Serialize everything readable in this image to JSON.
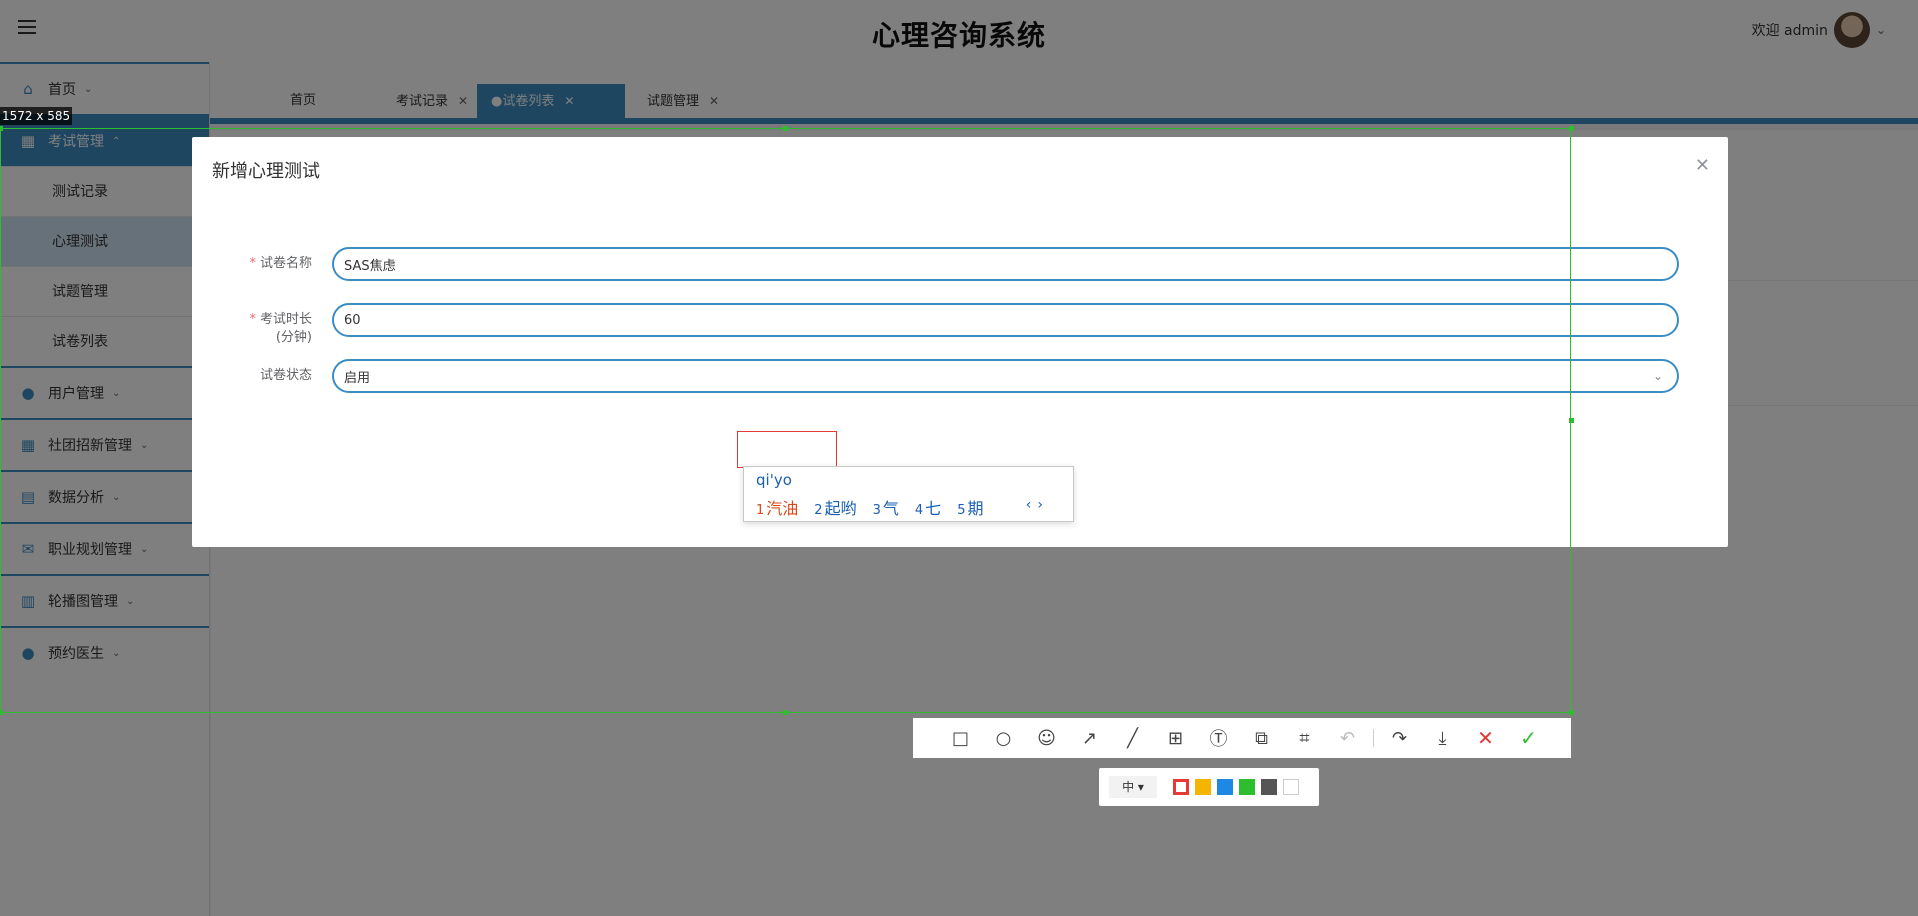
{
  "header": {
    "title": "心理咨询系统",
    "welcome": "欢迎 admin"
  },
  "sidebar": {
    "items": [
      {
        "label": "首页",
        "icon": "home-icon"
      },
      {
        "label": "考试管理",
        "icon": "grid-icon",
        "active": true,
        "children": [
          "测试记录",
          "心理测试",
          "试题管理",
          "试卷列表"
        ]
      },
      {
        "label": "用户管理",
        "icon": "user-icon"
      },
      {
        "label": "社团招新管理",
        "icon": "grid-icon"
      },
      {
        "label": "数据分析",
        "icon": "table-icon"
      },
      {
        "label": "职业规划管理",
        "icon": "mail-icon"
      },
      {
        "label": "轮播图管理",
        "icon": "columns-icon"
      },
      {
        "label": "预约医生",
        "icon": "user-icon"
      }
    ],
    "selected_child": "心理测试"
  },
  "tabs": [
    {
      "label": "首页"
    },
    {
      "label": "考试记录"
    },
    {
      "label": "●试卷列表",
      "active": true
    },
    {
      "label": "试题管理"
    }
  ],
  "dialog": {
    "title": "新增心理测试",
    "fields": {
      "name_label": "试卷名称",
      "name_value": "SAS焦虑",
      "duration_label": "考试时长",
      "duration_unit": "(分钟)",
      "duration_value": "60",
      "status_label": "试卷状态",
      "status_value": "启用"
    }
  },
  "screenshot_tool": {
    "size": "1572 x 585",
    "ime": {
      "composition": "qi'yo",
      "candidates": [
        "汽油",
        "起哟",
        "气",
        "七",
        "期"
      ],
      "numbers": [
        "1",
        "2",
        "3",
        "4",
        "5"
      ]
    },
    "toolbar": [
      "rect-icon",
      "ellipse-icon",
      "emoji-icon",
      "arrow-icon",
      "pen-icon",
      "mosaic-icon",
      "text-icon",
      "pin-icon",
      "ocr-icon",
      "undo-icon",
      "share-icon",
      "download-icon",
      "cancel-icon",
      "confirm-icon"
    ],
    "palette": {
      "size_label": "中",
      "colors": [
        "#e53935",
        "#f5b400",
        "#1e88e5",
        "#2ebd2e",
        "#555555",
        "#ffffff"
      ]
    }
  }
}
